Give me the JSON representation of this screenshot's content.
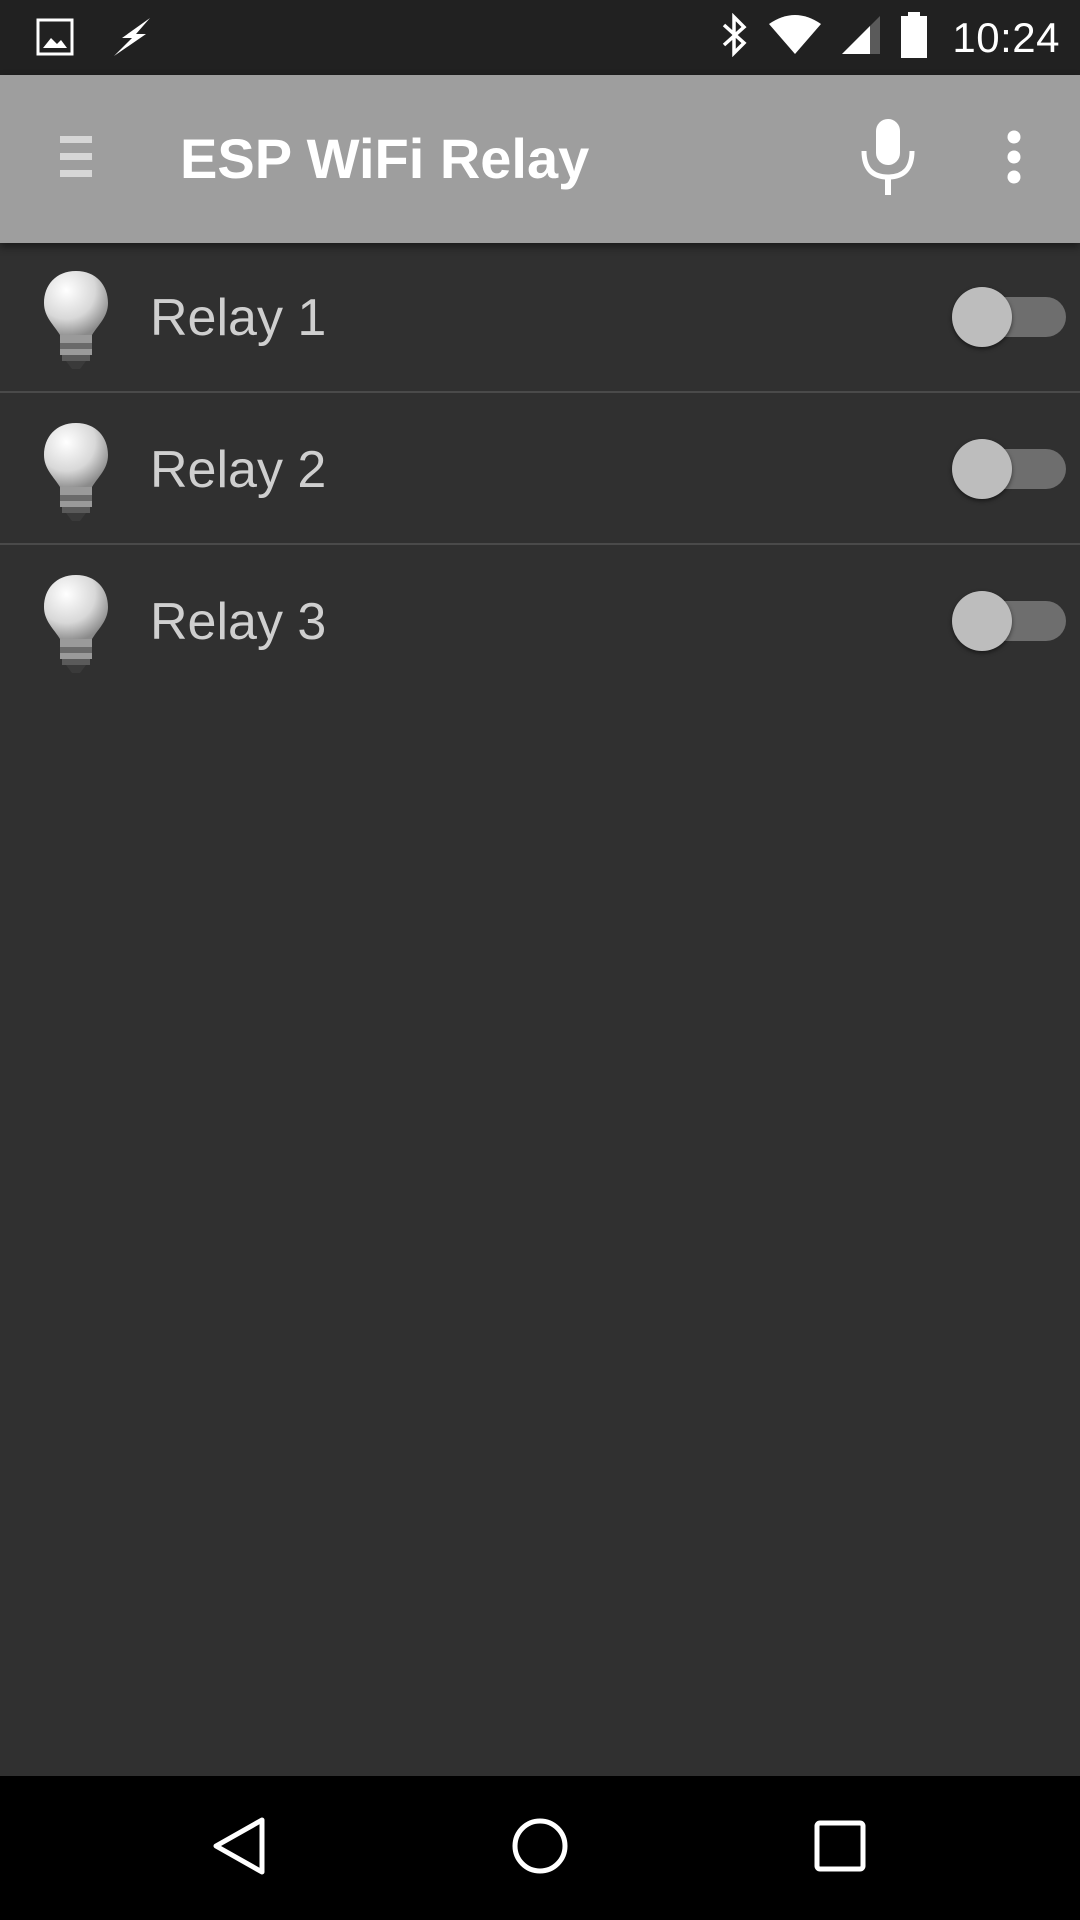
{
  "status_bar": {
    "time": "10:24",
    "icons": [
      "gallery-notification-icon",
      "flash-notification-icon",
      "bluetooth-icon",
      "wifi-icon",
      "cell-signal-icon",
      "battery-icon"
    ]
  },
  "app_bar": {
    "title": "ESP WiFi Relay",
    "icons": [
      "menu-icon",
      "microphone-icon",
      "overflow-menu-icon"
    ]
  },
  "relays": [
    {
      "label": "Relay 1",
      "on": false
    },
    {
      "label": "Relay 2",
      "on": false
    },
    {
      "label": "Relay 3",
      "on": false
    }
  ],
  "nav_bar": {
    "icons": [
      "back-icon",
      "home-icon",
      "recents-icon"
    ]
  },
  "colors": {
    "status_bar": "#212121",
    "app_bar": "#9e9e9e",
    "content_bg": "#303030",
    "switch_track": "#6e6e6e",
    "switch_thumb": "#bdbdbd"
  }
}
